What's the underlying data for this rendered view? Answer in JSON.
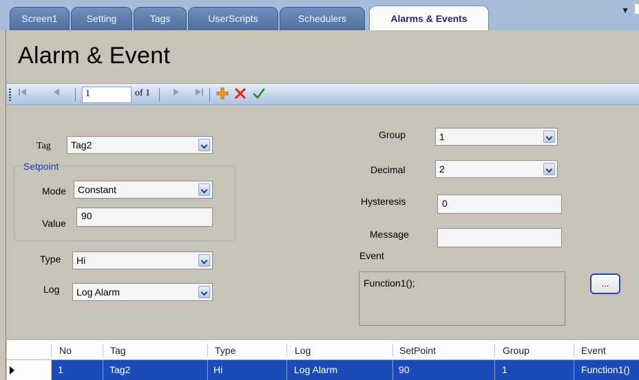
{
  "tabs": [
    {
      "label": "Screen1",
      "active": false
    },
    {
      "label": "Setting",
      "active": false
    },
    {
      "label": "Tags",
      "active": false
    },
    {
      "label": "UserScripts",
      "active": false
    },
    {
      "label": "Schedulers",
      "active": false
    },
    {
      "label": "Alarms & Events",
      "active": true
    }
  ],
  "page": {
    "title": "Alarm & Event"
  },
  "navigator": {
    "position": "1",
    "of_label": "of 1"
  },
  "form": {
    "tag_label": "Tag",
    "tag_value": "Tag2",
    "setpoint_legend": "Setpoint",
    "mode_label": "Mode",
    "mode_value": "Constant",
    "value_label": "Value",
    "value_value": "90",
    "type_label": "Type",
    "type_value": "Hi",
    "log_label": "Log",
    "log_value": "Log Alarm",
    "group_label": "Group",
    "group_value": "1",
    "decimal_label": "Decimal",
    "decimal_value": "2",
    "hysteresis_label": "Hysteresis",
    "hysteresis_value": "0",
    "message_label": "Message",
    "message_value": "",
    "event_label": "Event",
    "event_value": "Function1();",
    "browse_label": "..."
  },
  "grid": {
    "columns": [
      "No",
      "Tag",
      "Type",
      "Log",
      "SetPoint",
      "Group",
      "Event"
    ],
    "rows": [
      {
        "No": "1",
        "Tag": "Tag2",
        "Type": "Hi",
        "Log": "Log Alarm",
        "SetPoint": "90",
        "Group": "1",
        "Event": "Function1()"
      }
    ]
  },
  "colors": {
    "tab_strip": "#a7bddb",
    "active_tab_text": "#1c2c6e",
    "form_background": "#c7c3b9",
    "setpoint_legend": "#1b3aa8",
    "selected_row": "#1b4bb8",
    "add_icon": "#f0a020",
    "delete_icon": "#e02010",
    "accept_icon": "#1a8a1a"
  }
}
